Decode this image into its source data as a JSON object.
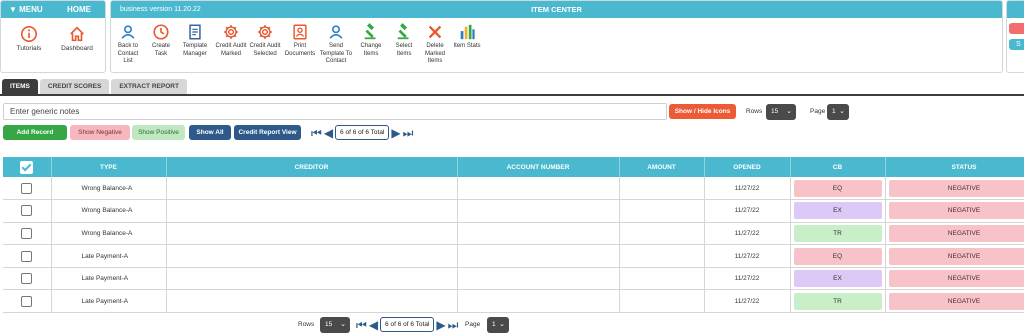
{
  "menu": {
    "menu_label": "MENU",
    "home_label": "HOME",
    "tools": [
      {
        "label": "Tutorials",
        "icon": "info-icon",
        "color": "#e8582e"
      },
      {
        "label": "Dashboard",
        "icon": "home-icon",
        "color": "#e8582e"
      }
    ]
  },
  "item_center": {
    "version": "business version 11.20.22",
    "title": "ITEM CENTER",
    "tools": [
      {
        "label": "Back to Contact List",
        "icon": "user-icon",
        "color": "#2f7ec1"
      },
      {
        "label": "Create Task",
        "icon": "clock-icon",
        "color": "#e8582e"
      },
      {
        "label": "Template Manager",
        "icon": "document-icon",
        "color": "#2f5fa0"
      },
      {
        "label": "Credit Audit Marked",
        "icon": "gear-icon",
        "color": "#e8582e"
      },
      {
        "label": "Credit Audit Selected",
        "icon": "gear-icon",
        "color": "#e8582e"
      },
      {
        "label": "Print Documents",
        "icon": "print-portrait-icon",
        "color": "#e8582e"
      },
      {
        "label": "Send Template To Contact",
        "icon": "user-icon",
        "color": "#2f7ec1"
      },
      {
        "label": "Change Items",
        "icon": "gavel-icon",
        "color": "#35a845"
      },
      {
        "label": "Select Items",
        "icon": "gavel-icon",
        "color": "#35a845"
      },
      {
        "label": "Delete Marked Items",
        "icon": "close-icon",
        "color": "#e8582e"
      },
      {
        "label": "Item Stats",
        "icon": "bar-chart-icon",
        "color": "#2f7ec1"
      }
    ]
  },
  "right_panel": {
    "blue_tab_label": "S"
  },
  "tabs": [
    {
      "label": "ITEMS",
      "active": true
    },
    {
      "label": "CREDIT SCORES",
      "active": false
    },
    {
      "label": "EXTRACT REPORT",
      "active": false
    }
  ],
  "toolbar": {
    "notes_placeholder": "Enter generic notes",
    "show_hide_label": "Show / Hide Icons",
    "rows_label": "Rows",
    "rows_value": "15",
    "page_label": "Page",
    "page_value": "1",
    "add_record": "Add Record",
    "show_negative": "Show Negative",
    "show_positive": "Show Positive",
    "show_all": "Show All",
    "credit_report_view": "Credit Report View",
    "pager_count": "6 of 6 of 6 Total"
  },
  "table": {
    "columns": [
      "TYPE",
      "CREDITOR",
      "ACCOUNT NUMBER",
      "AMOUNT",
      "OPENED",
      "CB",
      "STATUS"
    ],
    "rows": [
      {
        "type": "Wrong Balance-A",
        "creditor": "",
        "account": "",
        "amount": "",
        "opened": "11/27/22",
        "cb": "EQ",
        "status": "NEGATIVE"
      },
      {
        "type": "Wrong Balance-A",
        "creditor": "",
        "account": "",
        "amount": "",
        "opened": "11/27/22",
        "cb": "EX",
        "status": "NEGATIVE"
      },
      {
        "type": "Wrong Balance-A",
        "creditor": "",
        "account": "",
        "amount": "",
        "opened": "11/27/22",
        "cb": "TR",
        "status": "NEGATIVE"
      },
      {
        "type": "Late Payment-A",
        "creditor": "",
        "account": "",
        "amount": "",
        "opened": "11/27/22",
        "cb": "EQ",
        "status": "NEGATIVE"
      },
      {
        "type": "Late Payment-A",
        "creditor": "",
        "account": "",
        "amount": "",
        "opened": "11/27/22",
        "cb": "EX",
        "status": "NEGATIVE"
      },
      {
        "type": "Late Payment-A",
        "creditor": "",
        "account": "",
        "amount": "",
        "opened": "11/27/22",
        "cb": "TR",
        "status": "NEGATIVE"
      }
    ]
  },
  "footer": {
    "rows_label": "Rows",
    "rows_value": "15",
    "pager_count": "6 of 6 of 6 Total",
    "page_label": "Page",
    "page_value": "1"
  }
}
